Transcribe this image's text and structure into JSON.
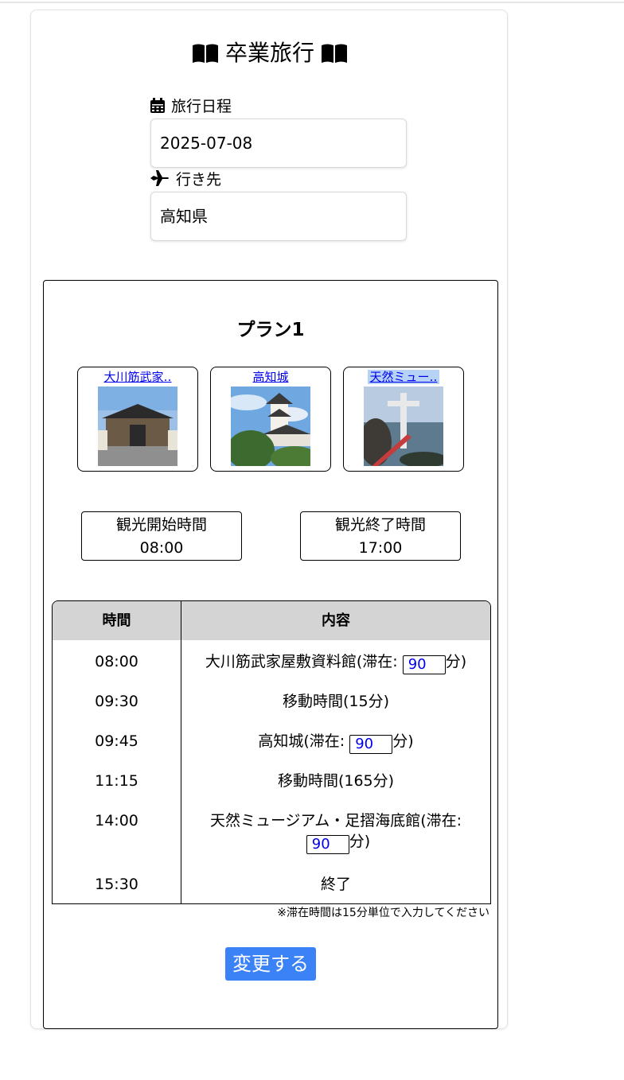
{
  "header": {
    "title": "卒業旅行",
    "title_icon": "open-book-icon"
  },
  "form": {
    "date_label": "旅行日程",
    "date_value": "2025-07-08",
    "destination_label": "行き先",
    "destination_value": "高知県"
  },
  "plan": {
    "title": "プラン1",
    "spots": [
      {
        "label": "大川筋武家‥",
        "highlighted": false
      },
      {
        "label": "高知城",
        "highlighted": false
      },
      {
        "label": "天然ミュー‥",
        "highlighted": true
      }
    ],
    "start_label": "観光開始時間",
    "start_value": "08:00",
    "end_label": "観光終了時間",
    "end_value": "17:00"
  },
  "schedule": {
    "headers": {
      "time": "時間",
      "content": "内容"
    },
    "rows": [
      {
        "time": "08:00",
        "content": "大川筋武家屋敷資料館(滞在:",
        "stay": "90",
        "unit": "分)"
      },
      {
        "time": "09:30",
        "content": "移動時間(15分)"
      },
      {
        "time": "09:45",
        "content": "高知城(滞在:",
        "stay": "90",
        "unit": "分)"
      },
      {
        "time": "11:15",
        "content": "移動時間(165分)"
      },
      {
        "time": "14:00",
        "content": "天然ミュージアム・足摺海底館(滞在:",
        "stay": "90",
        "unit": "分)"
      },
      {
        "time": "15:30",
        "content": "終了"
      }
    ],
    "note": "※滞在時間は15分単位で入力してください"
  },
  "actions": {
    "submit_label": "変更する"
  },
  "colors": {
    "accent": "#3b82f6",
    "link": "#0000ee",
    "table_header": "#d4d4d4"
  }
}
